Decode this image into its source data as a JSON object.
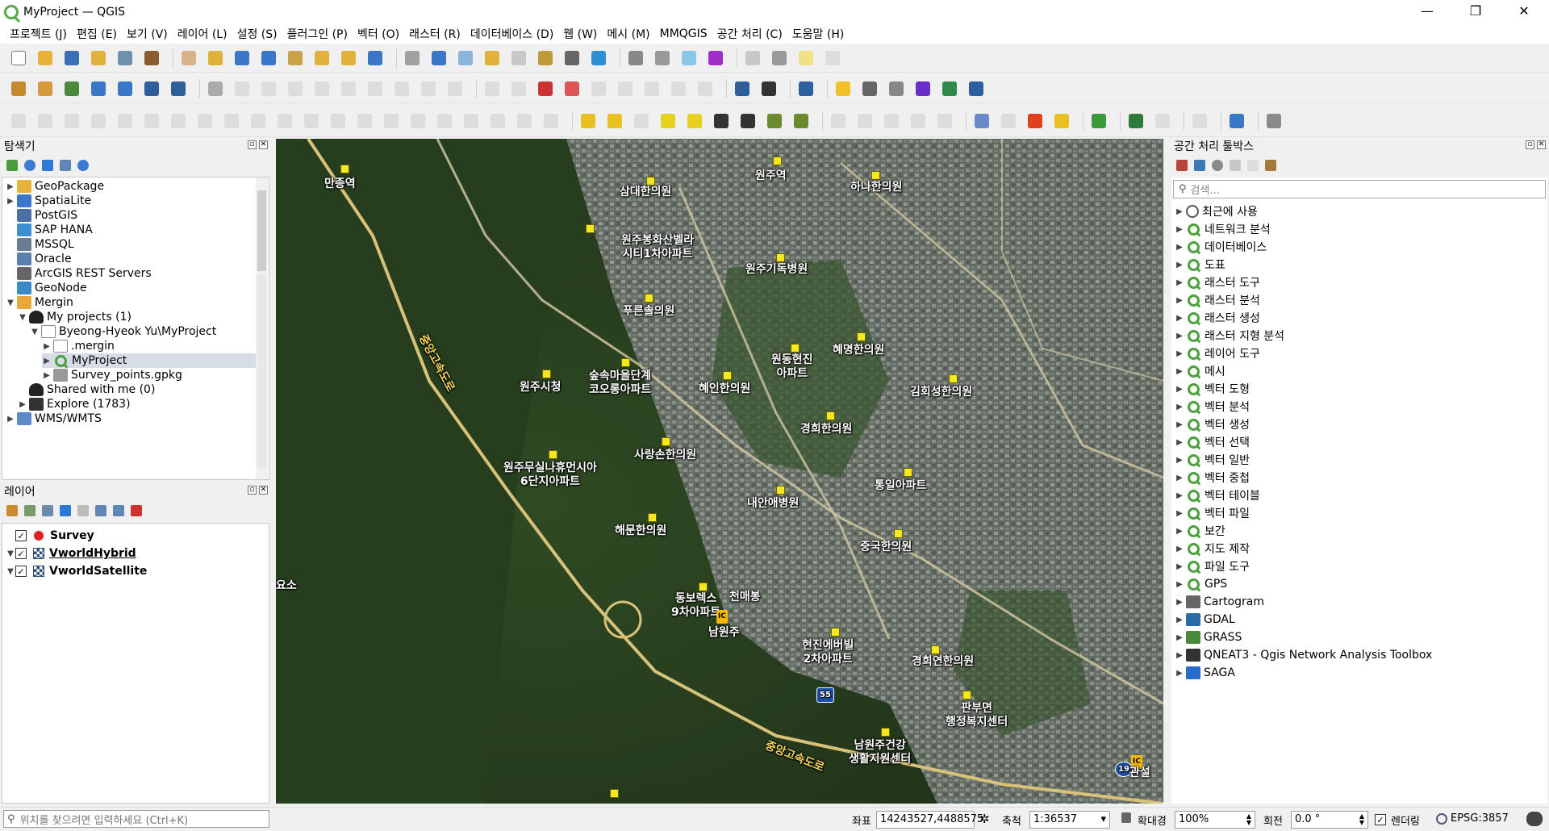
{
  "window": {
    "title": "MyProject — QGIS",
    "controls": [
      "—",
      "❐",
      "✕"
    ]
  },
  "menu": [
    "프로젝트 (J)",
    "편집 (E)",
    "보기 (V)",
    "레이어 (L)",
    "설정 (S)",
    "플러그인 (P)",
    "벡터 (O)",
    "래스터 (R)",
    "데이터베이스 (D)",
    "웹 (W)",
    "메시 (M)",
    "MMQGIS",
    "공간 처리 (C)",
    "도움말 (H)"
  ],
  "browser": {
    "title": "탐색기",
    "items": [
      {
        "label": "GeoPackage",
        "icon": "geopackage-icon"
      },
      {
        "label": "SpatiaLite",
        "icon": "spatialite-icon"
      },
      {
        "label": "PostGIS",
        "icon": "postgis-icon"
      },
      {
        "label": "SAP HANA",
        "icon": "sap-hana-icon"
      },
      {
        "label": "MSSQL",
        "icon": "mssql-icon"
      },
      {
        "label": "Oracle",
        "icon": "oracle-icon"
      },
      {
        "label": "ArcGIS REST Servers",
        "icon": "arcgis-icon"
      },
      {
        "label": "GeoNode",
        "icon": "geonode-icon"
      },
      {
        "label": "Mergin",
        "icon": "mergin-icon"
      },
      {
        "label": "My projects (1)",
        "icon": "user-icon"
      },
      {
        "label": "Byeong-Hyeok Yu\\MyProject",
        "icon": "folder-icon"
      },
      {
        "label": ".mergin",
        "icon": "folder-icon"
      },
      {
        "label": "MyProject",
        "icon": "qgis-project-icon"
      },
      {
        "label": "Survey_points.gpkg",
        "icon": "database-icon"
      },
      {
        "label": "Shared with me (0)",
        "icon": "users-icon"
      },
      {
        "label": "Explore (1783)",
        "icon": "list-icon"
      },
      {
        "label": "WMS/WMTS",
        "icon": "wms-icon"
      }
    ]
  },
  "layers": {
    "title": "레이어",
    "items": [
      {
        "label": "Survey",
        "checked": "✓"
      },
      {
        "label": "VworldHybrid",
        "checked": "✓"
      },
      {
        "label": "VworldSatellite",
        "checked": "✓"
      }
    ]
  },
  "toolbox": {
    "title": "공간 처리 툴박스",
    "search_placeholder": "검색...",
    "items": [
      "최근에 사용",
      "네트워크 분석",
      "데이터베이스",
      "도표",
      "래스터 도구",
      "래스터 분석",
      "래스터 생성",
      "래스터 지형 분석",
      "레이어 도구",
      "메시",
      "벡터 도형",
      "벡터 분석",
      "벡터 생성",
      "벡터 선택",
      "벡터 일반",
      "벡터 중첩",
      "벡터 테이블",
      "벡터 파일",
      "보간",
      "지도 제작",
      "파일 도구",
      "GPS",
      "Cartogram",
      "GDAL",
      "GRASS",
      "QNEAT3 - Qgis Network Analysis Toolbox",
      "SAGA"
    ]
  },
  "map_labels": [
    "만종역",
    "삼대한의원",
    "원주역",
    "하나한의원",
    "원주봉화산벨라\n시티1차아파트",
    "원주기독병원",
    "푸른솔의원",
    "원동현진\n아파트",
    "혜명한의원",
    "원주시청",
    "숲속마을단계\n코오롱아파트",
    "혜인한의원",
    "김회성한의원",
    "경희한의원",
    "사랑손한의원",
    "원주무실나휴먼시아\n6단지아파트",
    "통일아파트",
    "내안애병원",
    "해문한의원",
    "중국한의원",
    "동보렉스\n9차아파트",
    "천매봉",
    "남원주",
    "현진에버빌\n2차아파트",
    "경희연한의원",
    "판부면\n행정복지센터",
    "남원주건강\n생활지원센터",
    "중앙고속도로",
    "중앙고속도로",
    "요소",
    "IC",
    "IC",
    "55",
    "19",
    "관설"
  ],
  "statusbar": {
    "locator_placeholder": "위치를 찾으려면 입력하세요 (Ctrl+K)",
    "coord_label": "좌표",
    "coord_value": "14243527,4488575",
    "scale_label": "축척",
    "scale_value": "1:36537",
    "magnifier_label": "확대경",
    "magnifier_value": "100%",
    "rotation_label": "회전",
    "rotation_value": "0.0 °",
    "render_label": "렌더링",
    "crs": "EPSG:3857"
  },
  "colors": {
    "accent": "#589632",
    "highlight": "#d6dde7",
    "survey_point": "#e02020"
  }
}
